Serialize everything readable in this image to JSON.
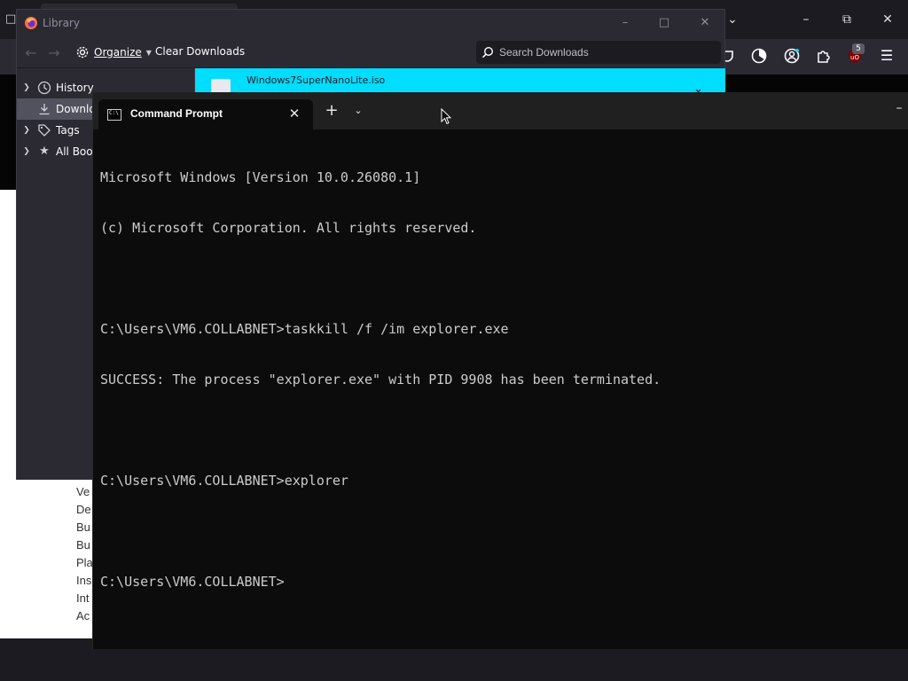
{
  "browser": {
    "web_links": [
      "Ve",
      "De",
      "Bu",
      "Bu",
      "Pla",
      "Ins",
      "Int",
      "Ac"
    ],
    "ublock_count": "5"
  },
  "library": {
    "title": "Library",
    "organize_label": "Organize",
    "clear_downloads_label": "Clear Downloads",
    "search_placeholder": "Search Downloads",
    "sidebar": [
      {
        "label": "History",
        "icon": "clock-icon"
      },
      {
        "label": "Downlo",
        "icon": "download-icon"
      },
      {
        "label": "Tags",
        "icon": "tag-icon"
      },
      {
        "label": "All Book",
        "icon": "star-icon"
      }
    ],
    "download": {
      "file_name": "Windows7SuperNanoLite.iso"
    },
    "accent_color": "#00ddff"
  },
  "terminal": {
    "tab_title": "Command Prompt",
    "lines": [
      "Microsoft Windows [Version 10.0.26080.1]",
      "(c) Microsoft Corporation. All rights reserved.",
      "",
      "C:\\Users\\VM6.COLLABNET>taskkill /f /im explorer.exe",
      "SUCCESS: The process \"explorer.exe\" with PID 9908 has been terminated.",
      "",
      "C:\\Users\\VM6.COLLABNET>explorer",
      "",
      "C:\\Users\\VM6.COLLABNET>"
    ]
  }
}
